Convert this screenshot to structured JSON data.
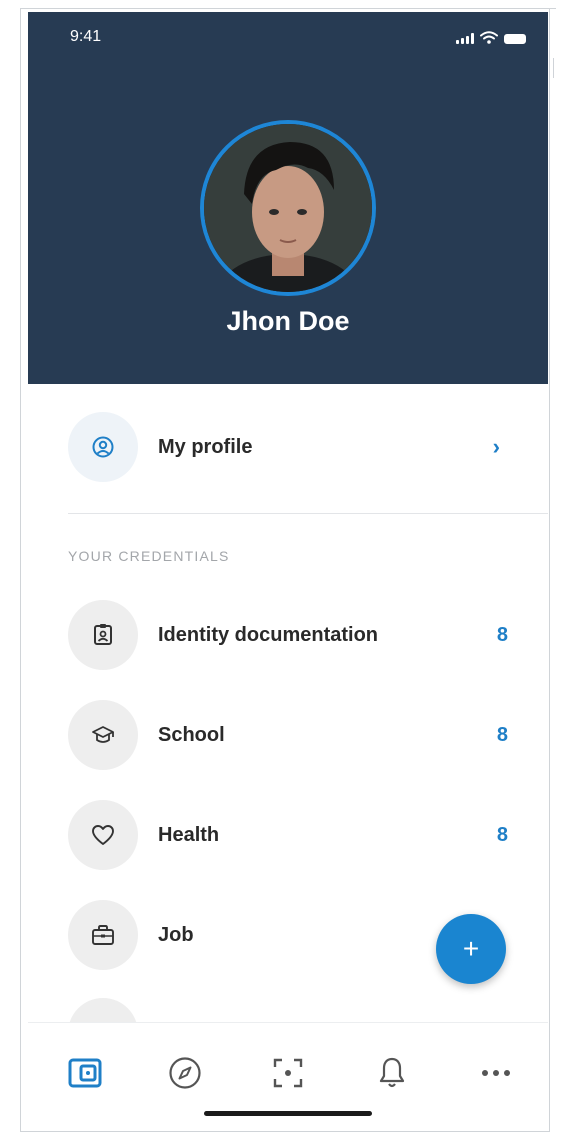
{
  "status_bar": {
    "time": "9:41"
  },
  "user": {
    "name": "Jhon Doe"
  },
  "profile_item": {
    "label": "My profile",
    "chevron": "›",
    "icon": "user-circle-icon"
  },
  "section_title": "YOUR CREDENTIALS",
  "credentials": [
    {
      "label": "Identity documentation",
      "count": "8",
      "icon": "id-card-icon"
    },
    {
      "label": "School",
      "count": "8",
      "icon": "graduation-cap-icon"
    },
    {
      "label": "Health",
      "count": "8",
      "icon": "heart-icon"
    },
    {
      "label": "Job",
      "count": "",
      "icon": "briefcase-icon"
    }
  ],
  "fab": {
    "label": "+"
  },
  "bottom_nav": [
    {
      "name": "wallet",
      "icon": "wallet-icon",
      "active": true
    },
    {
      "name": "explore",
      "icon": "compass-icon",
      "active": false
    },
    {
      "name": "scan",
      "icon": "scan-icon",
      "active": false
    },
    {
      "name": "notifications",
      "icon": "bell-icon",
      "active": false
    },
    {
      "name": "more",
      "icon": "more-icon",
      "active": false
    }
  ],
  "colors": {
    "header_bg": "#273b53",
    "accent": "#1f7fc7",
    "icon_bg": "#eeeeee"
  }
}
